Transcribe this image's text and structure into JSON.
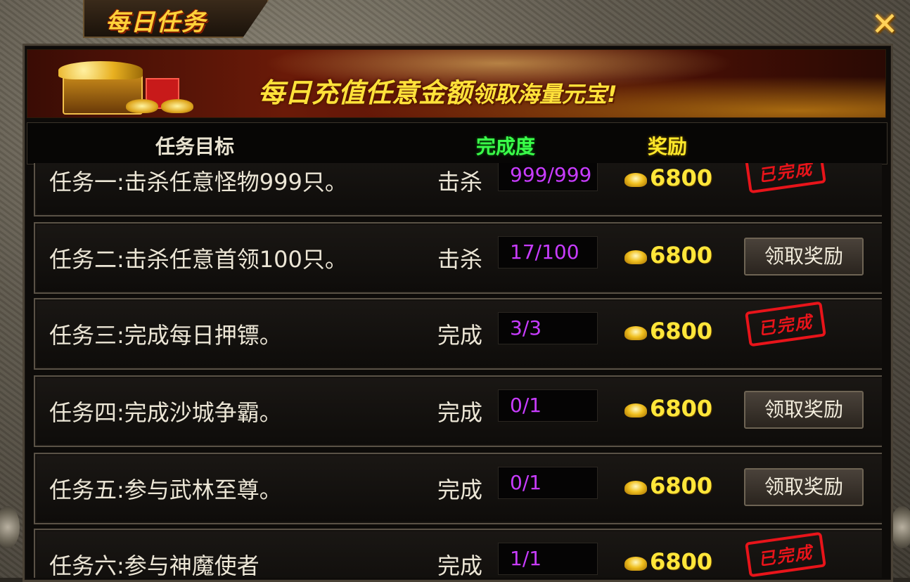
{
  "window": {
    "title": "每日任务",
    "close_icon": "✕"
  },
  "banner": {
    "text_big": "每日充值任意金额",
    "text_small": "领取海量元宝!"
  },
  "header": {
    "target": "任务目标",
    "progress": "完成度",
    "reward": "奖励"
  },
  "colors": {
    "progress_header": "#3aff4a",
    "reward_header": "#ffe82a",
    "progress_value": "#c83cff",
    "stamp": "#e8141a"
  },
  "tasks": [
    {
      "label": "任务一:击杀任意怪物999只。",
      "action": "击杀",
      "progress": "999/999",
      "reward": "6800",
      "status": "completed",
      "stamp_text": "已完成"
    },
    {
      "label": "任务二:击杀任意首领100只。",
      "action": "击杀",
      "progress": "17/100",
      "reward": "6800",
      "status": "claim",
      "button": "领取奖励"
    },
    {
      "label": "任务三:完成每日押镖。",
      "action": "完成",
      "progress": "3/3",
      "reward": "6800",
      "status": "completed",
      "stamp_text": "已完成"
    },
    {
      "label": "任务四:完成沙城争霸。",
      "action": "完成",
      "progress": "0/1",
      "reward": "6800",
      "status": "claim",
      "button": "领取奖励"
    },
    {
      "label": "任务五:参与武林至尊。",
      "action": "完成",
      "progress": "0/1",
      "reward": "6800",
      "status": "claim",
      "button": "领取奖励"
    },
    {
      "label": "任务六:参与神魔使者",
      "action": "完成",
      "progress": "1/1",
      "reward": "6800",
      "status": "completed",
      "stamp_text": "已完成"
    }
  ]
}
